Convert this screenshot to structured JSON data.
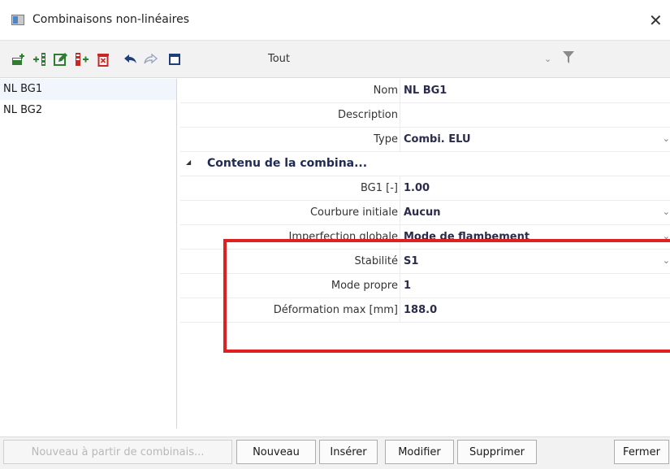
{
  "window": {
    "title": "Combinaisons non-linéaires",
    "close_glyph": "✕"
  },
  "toolbar": {
    "buttons": [
      {
        "icon": "new-item-icon",
        "color": "#2e7d32"
      },
      {
        "icon": "insert-item-icon",
        "color": "#2e7d32"
      },
      {
        "icon": "edit-icon",
        "color": "#2e7d32"
      },
      {
        "icon": "copy-item-icon",
        "color": "#c62828"
      },
      {
        "icon": "delete-icon",
        "color": "#c62828"
      },
      {
        "icon": "undo-icon",
        "color": "#1f3f7a"
      },
      {
        "icon": "redo-icon",
        "color": "#9aa6bf"
      },
      {
        "icon": "table-icon",
        "color": "#1f3f7a"
      }
    ],
    "filter_value": "Tout",
    "filter_arrow": "⌄",
    "funnel_icon": "filter-icon"
  },
  "list": {
    "items": [
      {
        "label": "NL BG1",
        "selected": true
      },
      {
        "label": "NL BG2",
        "selected": false
      }
    ]
  },
  "properties": {
    "nom": {
      "label": "Nom",
      "value": "NL BG1"
    },
    "description": {
      "label": "Description",
      "value": ""
    },
    "type": {
      "label": "Type",
      "value": "Combi. ELU"
    },
    "section": {
      "title": "Contenu de la combina...",
      "toggle": "◢"
    },
    "bg1": {
      "label": "BG1 [-]",
      "value": "1.00"
    },
    "courbure": {
      "label": "Courbure initiale",
      "value": "Aucun"
    },
    "imperfection": {
      "label": "Imperfection globale",
      "value": "Mode de flambement"
    },
    "stabilite": {
      "label": "Stabilité",
      "value": "S1"
    },
    "mode_propre": {
      "label": "Mode propre",
      "value": "1"
    },
    "deformation": {
      "label": "Déformation max [mm]",
      "value": "188.0"
    },
    "chevron": "⌄"
  },
  "highlight_color": "#e02020",
  "buttons": {
    "new_from": "Nouveau à partir de combinais...",
    "new": "Nouveau",
    "insert": "Insérer",
    "modify": "Modifier",
    "delete": "Supprimer",
    "close": "Fermer"
  }
}
